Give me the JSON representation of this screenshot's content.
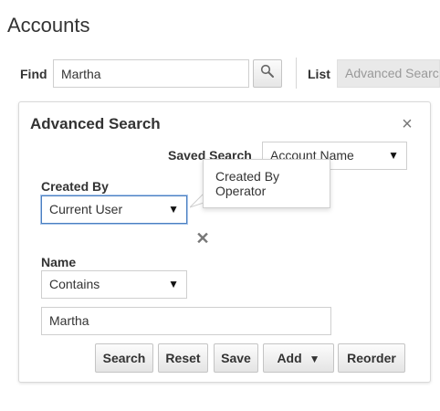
{
  "page": {
    "title": "Accounts"
  },
  "search": {
    "find_label": "Find",
    "find_value": "Martha",
    "list_label": "List",
    "list_value": "Advanced Search"
  },
  "panel": {
    "title": "Advanced Search",
    "saved_search_label": "Saved Search",
    "saved_search_value": "Account Name",
    "created_by_label": "Created By",
    "created_by_value": "Current User",
    "tooltip": "Created By Operator",
    "name_label": "Name",
    "name_operator": "Contains",
    "name_value": "Martha"
  },
  "buttons": {
    "search": "Search",
    "reset": "Reset",
    "save": "Save",
    "add": "Add",
    "reorder": "Reorder"
  },
  "icons": {
    "find_search": "search-icon",
    "close": "close-icon",
    "remove": "remove-icon",
    "dropdown": "caret-down-icon"
  },
  "colors": {
    "focus_border": "#4a7fc1",
    "text": "#333333"
  }
}
